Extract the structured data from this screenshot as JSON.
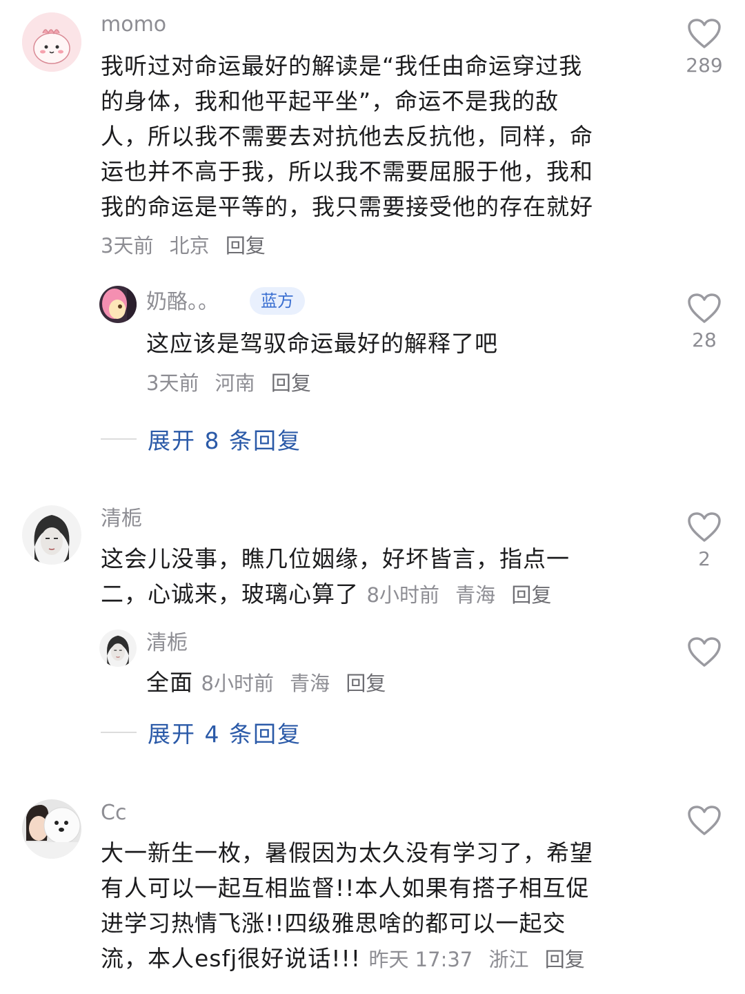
{
  "colors": {
    "username": "#8d8d93",
    "text": "#1c1c1e",
    "meta": "#8d8d93",
    "expand_link": "#2b5aa8",
    "tag_text": "#3a6fd1",
    "tag_bg": "#e9f0fd"
  },
  "comments": [
    {
      "username": "momo",
      "avatar_icon": "pink-bunny-avatar-icon",
      "text_lines": [
        "我听过对命运最好的解读是“我任由命运穿过我",
        "的身体，我和他平起平坐”，命运不是我的敌",
        "人，所以我不需要去对抗他去反抗他，同样，命",
        "运也并不高于我，所以我不需要屈服于他，我和",
        "我的命运是平等的，我只需要接受他的存在就好"
      ],
      "time": "3天前",
      "location": "北京",
      "reply_label": "回复",
      "likes": "289",
      "replies": [
        {
          "username": "奶酪。。",
          "tag": "蓝方",
          "text": "这应该是驾驭命运最好的解释了吧",
          "time": "3天前",
          "location": "河南",
          "reply_label": "回复",
          "likes": "28"
        }
      ],
      "expand_label": "展开 8 条回复"
    },
    {
      "username": "清栀",
      "avatar_icon": "ink-portrait-avatar-icon",
      "text_lines": [
        "这会儿没事，瞧几位姻缘，好坏皆言，指点一",
        "二，心诚来，玻璃心算了"
      ],
      "time": "8小时前",
      "location": "青海",
      "reply_label": "回复",
      "likes": "2",
      "replies": [
        {
          "username": "清栀",
          "text": "全面",
          "time": "8小时前",
          "location": "青海",
          "reply_label": "回复",
          "likes": ""
        }
      ],
      "expand_label": "展开 4 条回复"
    },
    {
      "username": "Cc",
      "avatar_icon": "person-with-dog-avatar-icon",
      "text_lines": [
        "大一新生一枚，暑假因为太久没有学习了，希望",
        "有人可以一起互相监督!!本人如果有搭子相互促",
        "进学习热情飞涨!!四级雅思啥的都可以一起交",
        "流，本人esfj很好说话!!!"
      ],
      "time": "昨天 17:37",
      "location": "浙江",
      "reply_label": "回复",
      "likes": ""
    }
  ]
}
